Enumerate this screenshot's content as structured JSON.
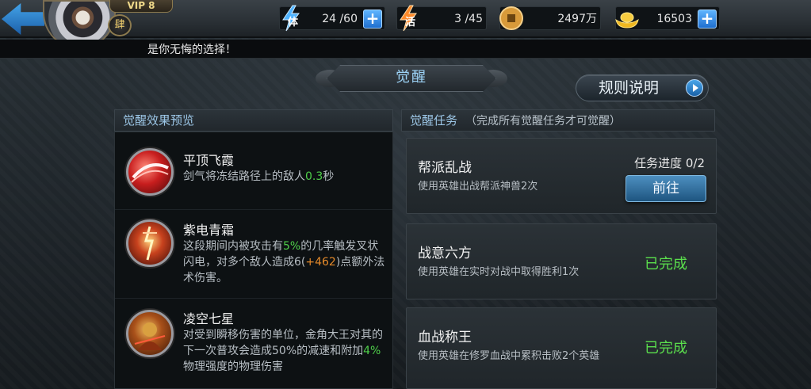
{
  "header": {
    "vip": "VIP 8",
    "rank": "肆",
    "resources": [
      {
        "name": "体",
        "value": "24 /60",
        "icon": "stamina-lightning-icon",
        "has_plus": true
      },
      {
        "name": "活",
        "value": "3 /45",
        "icon": "vitality-lightning-icon",
        "has_plus": false
      },
      {
        "name": "coins",
        "value": "2497万",
        "icon": "coin-icon",
        "has_plus": false
      },
      {
        "name": "gold",
        "value": "16503",
        "icon": "gold-ingot-icon",
        "has_plus": true
      }
    ]
  },
  "ticker": "是你无悔的选择！",
  "page": {
    "title": "觉醒",
    "rules_button": "规则说明"
  },
  "preview": {
    "heading": "觉醒效果预览",
    "skills": [
      {
        "name": "平顶飞霞",
        "desc_parts": [
          "剑气将冻结路径上的敌人",
          "0.3",
          "秒"
        ]
      },
      {
        "name": "紫电青霜",
        "desc_parts": [
          "这段期间内被攻击有",
          "5%",
          "的几率触发叉状闪电，对多个敌人造成6(",
          "+462",
          ")点额外法术伤害。"
        ]
      },
      {
        "name": "凌空七星",
        "desc_parts": [
          "对受到瞬移伤害的单位，金角大王对其的下一次普攻会造成50%的减速和附加",
          "4%",
          "物理强度的物理伤害"
        ]
      }
    ]
  },
  "tasks": {
    "heading": "觉醒任务",
    "subheading": "（完成所有觉醒任务才可觉醒）",
    "items": [
      {
        "name": "帮派乱战",
        "desc": "使用英雄出战帮派神兽2次",
        "progress": "任务进度 0/2",
        "button": "前往"
      },
      {
        "name": "战意六方",
        "desc": "使用英雄在实时对战中取得胜利1次",
        "status": "已完成"
      },
      {
        "name": "血战称王",
        "desc": "使用英雄在修罗血战中累积击败2个英雄",
        "status": "已完成"
      }
    ]
  },
  "colors": {
    "accent_blue": "#4aa7ea",
    "complete_green": "#5be04d",
    "highlight_green": "#4fcf4a",
    "highlight_orange": "#e58a2a"
  }
}
